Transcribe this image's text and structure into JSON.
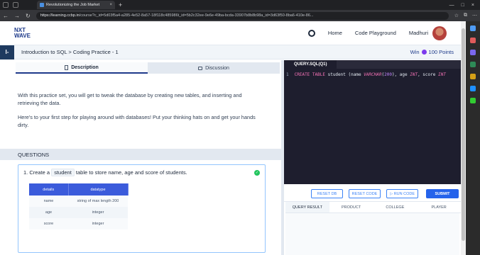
{
  "browser": {
    "tab_title": "Revolutionizing the Job Market",
    "close_glyph": "×",
    "new_tab_glyph": "+",
    "url_host": "https://learning.ccbp.in",
    "url_path": "/course?c_id=5d03f5a4-a285-4e52-8a57-18f118c485986t_id=5b2c32ee-9e6e-49ba-bcda-33907b8b8b98a_id=3d63f50-8ba6-410e-86...",
    "nav_glyphs": [
      "←",
      "→",
      "↻"
    ],
    "window_controls": [
      "—",
      "□",
      "×"
    ]
  },
  "site": {
    "logo_line1": "NXT",
    "logo_line2": "WAVE",
    "nav": [
      "Home",
      "Code Playground"
    ],
    "user_name": "Madhuri"
  },
  "subheader": {
    "menu_glyph": "I-",
    "breadcrumb": "Introduction to SQL > Coding Practice - 1",
    "win_label": "Win",
    "points": "100 Points"
  },
  "left_tabs": [
    "Description",
    "Discussion"
  ],
  "description": [
    "With this practice set, you will get to tweak the database by creating new tables, and inserting and retrieving the data.",
    "Here's to your first step for playing around with databases! Put your thinking hats on and get your hands dirty."
  ],
  "questions": {
    "heading": "QUESTIONS",
    "q1_prefix": "1.  Create a",
    "q1_code": "student",
    "q1_suffix": "table to store name, age and score of students.",
    "check_glyph": "✓",
    "table_headers": [
      "details",
      "datatype"
    ],
    "table_rows": [
      [
        "name",
        "string of max length 200"
      ],
      [
        "age",
        "integer"
      ],
      [
        "score",
        "integer"
      ]
    ]
  },
  "editor": {
    "file_tab": "QUERY.SQL(Q1)",
    "line_no": "1",
    "code": {
      "kw1": "CREATE TABLE",
      "t1": " student (name ",
      "ty1": "VARCHAR",
      "t2": "(",
      "n1": "200",
      "t3": "), age ",
      "ty2": "INT",
      "t4": ", score ",
      "ty3": "INT"
    }
  },
  "buttons": {
    "reset_db": "RESET DB",
    "reset_code": "RESET CODE",
    "run_code": "RUN CODE",
    "submit": "SUBMIT"
  },
  "result_tabs": [
    "QUERY RESULT",
    "PRODUCT",
    "COLLEGE",
    "PLAYER"
  ],
  "colors": {
    "brand_blue": "#1e3a8a",
    "accent_blue": "#2563eb",
    "editor_bg": "#1e1e2e",
    "success": "#22c55e"
  }
}
